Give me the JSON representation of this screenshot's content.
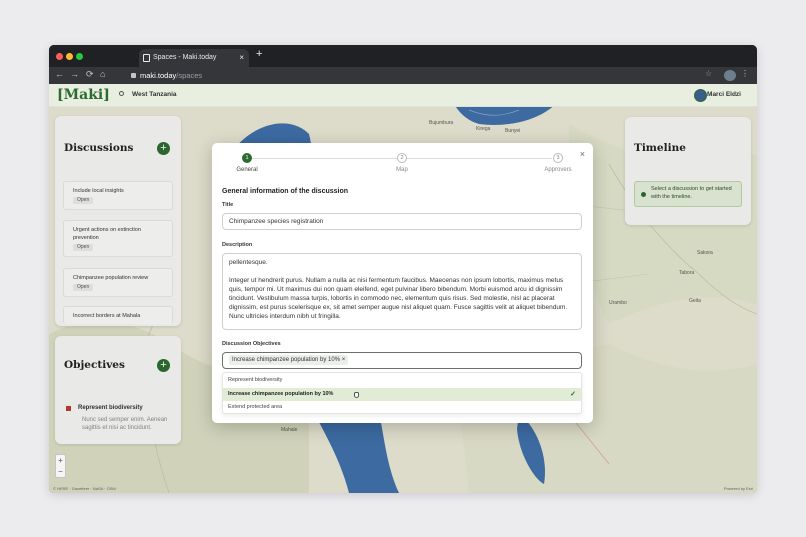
{
  "browser": {
    "tab_title": "Spaces - Maki.today",
    "url_host": "maki.today",
    "url_path": "/spaces",
    "new_tab": "+",
    "tab_close": "×",
    "nav": {
      "back": "←",
      "forward": "→",
      "reload": "⟳",
      "home": "⌂",
      "star": "☆",
      "menu": "⋮"
    }
  },
  "app": {
    "logo": "[Maki]",
    "region": "West Tanzania",
    "user_name": "Marci Eldzi"
  },
  "discussions": {
    "title": "Discussions",
    "add": "+",
    "items": [
      {
        "title": "Include local insights",
        "status": "Open"
      },
      {
        "title": "Urgent actions on extinction prevention",
        "status": "Open"
      },
      {
        "title": "Chimpanzee population review",
        "status": "Open"
      },
      {
        "title": "Incorrect borders at Mahala",
        "status": ""
      }
    ]
  },
  "objectives": {
    "title": "Objectives",
    "add": "+",
    "item_title": "Represent biodiversity",
    "item_desc": "Nunc sed semper enim. Aenean sagittis et nisi ac tincidunt."
  },
  "timeline": {
    "title": "Timeline",
    "message": "Select a discussion to get started with the timeline."
  },
  "map": {
    "zoom_in": "+",
    "zoom_out": "−",
    "attribution_left": "© HERE · Gazetteer · NaSA · OSM",
    "attribution_right": "Powered by Esri",
    "labels": [
      {
        "text": "Bujumbura"
      },
      {
        "text": "Kirega"
      },
      {
        "text": "Bunyei"
      },
      {
        "text": "Sakora"
      },
      {
        "text": "Tabora"
      },
      {
        "text": "Urambo"
      },
      {
        "text": "Mahale"
      },
      {
        "text": "Geita"
      }
    ]
  },
  "modal": {
    "close": "×",
    "steps": [
      {
        "num": "1",
        "label": "General",
        "active": true
      },
      {
        "num": "2",
        "label": "Map",
        "active": false
      },
      {
        "num": "3",
        "label": "Approvers",
        "active": false
      }
    ],
    "section_title": "General information of the discussion",
    "title_label": "Title",
    "title_value": "Chimpanzee species registration",
    "description_label": "Description",
    "description_p1": "pellentesque.",
    "description_p2": "Integer ut hendrerit purus. Nullam a nulla ac nisi fermentum faucibus. Maecenas non ipsum lobortis, maximus metus quis, tempor mi. Ut maximus dui non quam eleifend, eget pulvinar libero bibendum. Morbi euismod arcu id dignissim tincidunt. Vestibulum massa turpis, lobortis in commodo nec, elementum quis risus. Sed molestie, nisl ac placerat dignissim, est purus scelerisque ex, sit amet semper augue nisl aliquet quam. Fusce sagittis velit at aliquet bibendum. Nunc ultricies interdum nibh ut fringilla.",
    "objectives_label": "Discussion Objectives",
    "selected_chip": "Increase chimpanzee population by 10%",
    "chip_remove": "×",
    "options": [
      {
        "label": "Represent biodiversity",
        "selected": false
      },
      {
        "label": "Increase chimpanzee population by 10%",
        "selected": true
      },
      {
        "label": "Extend protected area",
        "selected": false
      }
    ],
    "check": "✓"
  }
}
